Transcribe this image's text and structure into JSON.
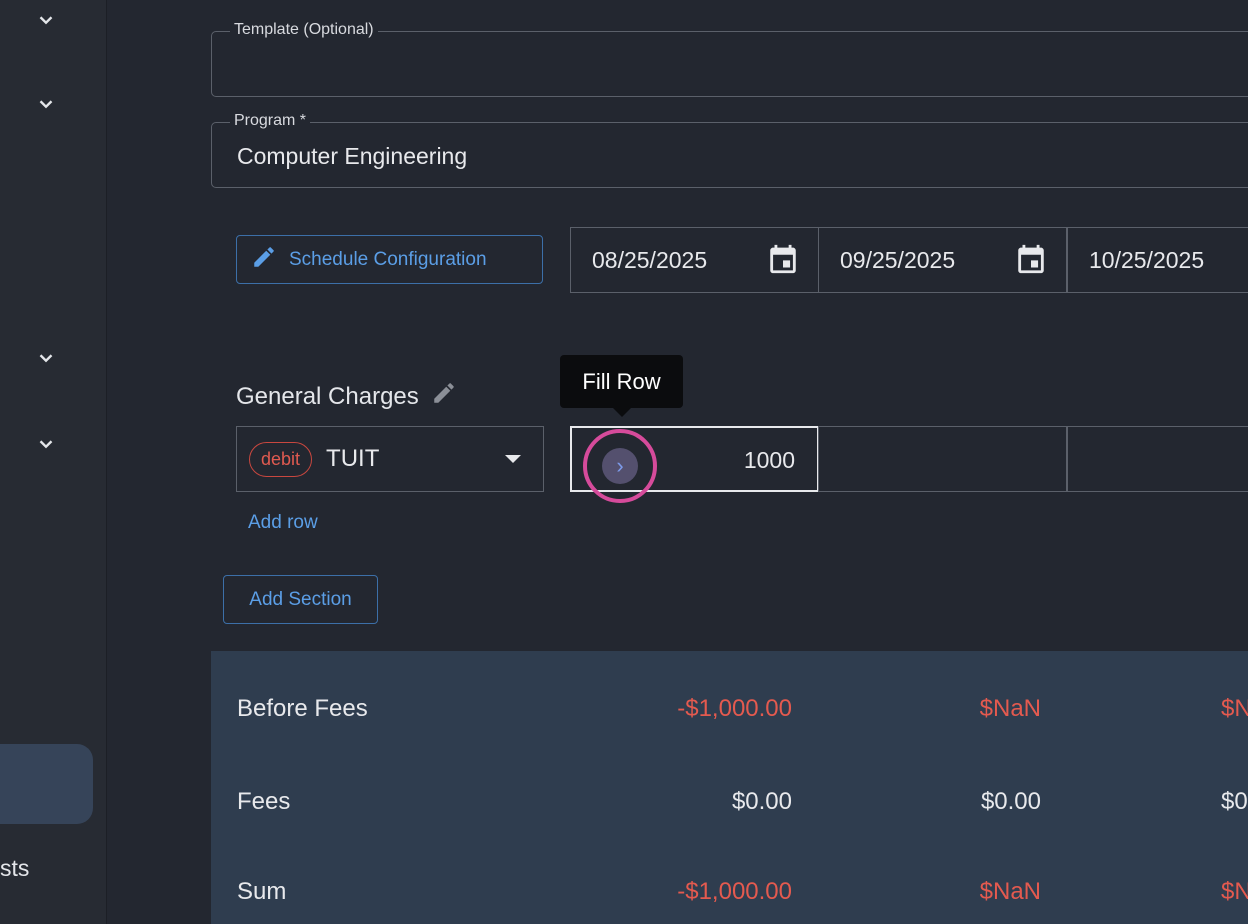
{
  "sidebar": {
    "partial_label": "sts"
  },
  "form": {
    "template": {
      "label": "Template (Optional)",
      "value": ""
    },
    "program": {
      "label": "Program *",
      "value": "Computer Engineering"
    }
  },
  "schedule": {
    "button_label": "Schedule Configuration",
    "dates": [
      "08/25/2025",
      "09/25/2025",
      "10/25/2025"
    ]
  },
  "section": {
    "title": "General Charges",
    "row": {
      "chip": "debit",
      "code": "TUIT",
      "amounts": [
        "1000",
        "",
        ""
      ]
    },
    "tooltip": "Fill Row",
    "add_row_label": "Add row",
    "add_section_label": "Add Section"
  },
  "summary": {
    "rows": [
      {
        "label": "Before Fees",
        "values": [
          "-$1,000.00",
          "$NaN",
          "$N"
        ]
      },
      {
        "label": "Fees",
        "values": [
          "$0.00",
          "$0.00",
          "$0"
        ]
      },
      {
        "label": "Sum",
        "values": [
          "-$1,000.00",
          "$NaN",
          "$N"
        ]
      }
    ]
  },
  "colors": {
    "accent": "#5b9ee6",
    "negative": "#e45a4f",
    "highlight_ring": "#d64b9b"
  }
}
